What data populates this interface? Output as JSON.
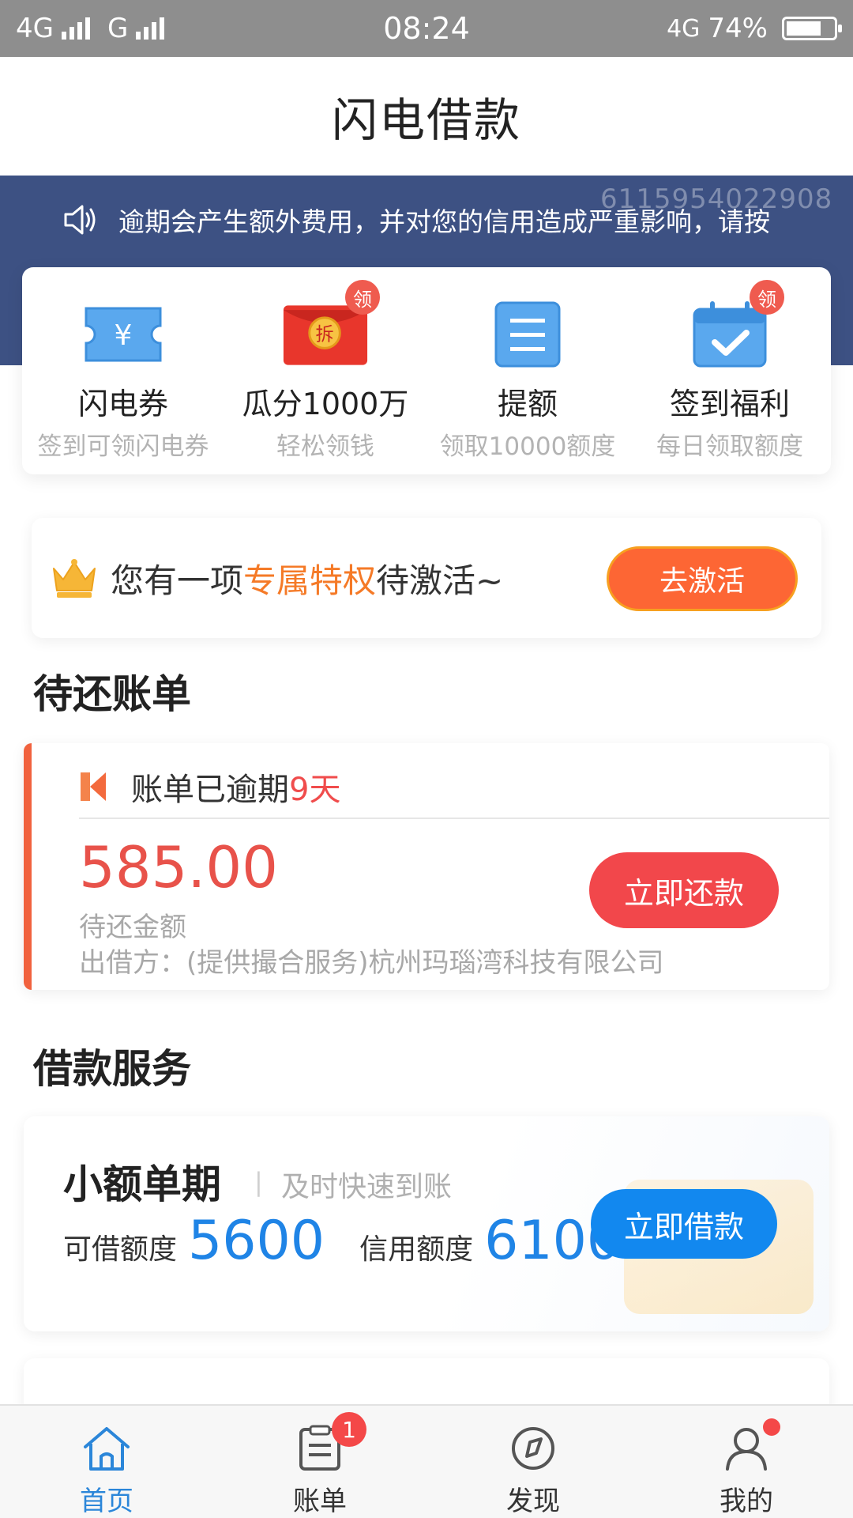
{
  "status_bar": {
    "network_left": "4G",
    "network_mid": "G",
    "time": "08:24",
    "network_right": "4G",
    "battery": "74%",
    "battery_level": 0.74
  },
  "header": {
    "title": "闪电借款"
  },
  "notice": {
    "text": "逾期会产生额外费用，并对您的信用造成严重影响，请按",
    "watermark": "61159540229​08",
    "icon": "speaker-icon"
  },
  "quick_menu": [
    {
      "title": "闪电券",
      "subtitle": "签到可领闪电券",
      "icon": "coupon-icon",
      "badge": ""
    },
    {
      "title": "瓜分1000万",
      "subtitle": "轻松领钱",
      "icon": "red-envelope-icon",
      "badge": "领",
      "icon_text": "拆"
    },
    {
      "title": "提额",
      "subtitle": "领取10000额度",
      "icon": "document-icon",
      "badge": ""
    },
    {
      "title": "签到福利",
      "subtitle": "每日领取额度",
      "icon": "calendar-check-icon",
      "badge": "领"
    }
  ],
  "privilege": {
    "prefix": "您有一项",
    "highlight": "专属特权",
    "suffix": "待激活~",
    "button": "去激活"
  },
  "bills": {
    "section_title": "待还账单",
    "status_prefix": "账单已逾期",
    "overdue_days": "9天",
    "amount": "585.00",
    "amount_label": "待还金额",
    "lender": "出借方：(提供撮合服务)杭州玛瑙湾科技有限公司",
    "button": "立即还款"
  },
  "loan_service": {
    "section_title": "借款服务",
    "product_title": "小额单期",
    "divider": "|",
    "product_subtitle": "及时快速到账",
    "available_label": "可借额度",
    "available_value": "5600",
    "credit_label": "信用额度",
    "credit_value": "6100",
    "button": "立即借款"
  },
  "bottom_nav": [
    {
      "label": "首页",
      "icon": "home-icon",
      "active": true
    },
    {
      "label": "账单",
      "icon": "bill-icon",
      "badge": "1"
    },
    {
      "label": "发现",
      "icon": "compass-icon"
    },
    {
      "label": "我的",
      "icon": "user-icon",
      "dot": true
    }
  ],
  "colors": {
    "banner": "#3d5183",
    "accent_orange": "#fd6634",
    "accent_red": "#f2474b",
    "accent_blue": "#1288ef",
    "nav_active": "#2b86d9"
  }
}
